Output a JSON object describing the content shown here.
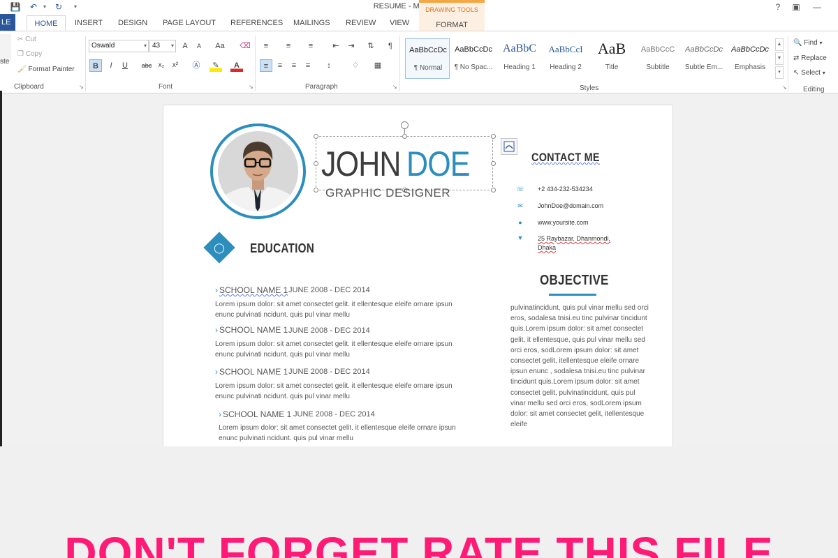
{
  "window": {
    "title": "RESUME - Microsoft Word",
    "help": "?"
  },
  "tabs": {
    "file": "LE",
    "home": "HOME",
    "insert": "INSERT",
    "design": "DESIGN",
    "page_layout": "PAGE LAYOUT",
    "references": "REFERENCES",
    "mailings": "MAILINGS",
    "review": "REVIEW",
    "view": "VIEW",
    "contextual_group": "DRAWING TOOLS",
    "format": "FORMAT"
  },
  "clipboard": {
    "paste": "ste",
    "cut": "Cut",
    "copy": "Copy",
    "format_painter": "Format Painter",
    "label": "Clipboard"
  },
  "font": {
    "family": "Oswald",
    "size": "43",
    "bold": "B",
    "italic": "I",
    "underline": "U",
    "strike": "abc",
    "subscript": "x₂",
    "superscript": "x²",
    "grow": "A",
    "shrink": "A",
    "change_case": "Aa",
    "label": "Font"
  },
  "paragraph": {
    "label": "Paragraph"
  },
  "styles": {
    "label": "Styles",
    "items": [
      {
        "preview": "AaBbCcDc",
        "name": "¶ Normal"
      },
      {
        "preview": "AaBbCcDc",
        "name": "¶ No Spac..."
      },
      {
        "preview": "AaBbC",
        "name": "Heading 1"
      },
      {
        "preview": "AaBbCcI",
        "name": "Heading 2"
      },
      {
        "preview": "AaB",
        "name": "Title"
      },
      {
        "preview": "AaBbCcC",
        "name": "Subtitle"
      },
      {
        "preview": "AaBbCcDc",
        "name": "Subtle Em..."
      },
      {
        "preview": "AaBbCcDc",
        "name": "Emphasis"
      }
    ]
  },
  "editing": {
    "find": "Find",
    "replace": "Replace",
    "select": "Select",
    "label": "Editing"
  },
  "resume": {
    "first_name": "JOHN",
    "last_name": "DOE",
    "job_title": "GRAPHIC DESIGNER",
    "education_heading": "EDUCATION",
    "education": [
      {
        "school": "SCHOOL NAME 1",
        "dates": "JUNE 2008 - DEC 2014",
        "desc": "Lorem ipsum dolor: sit amet consectet gelit. it ellentesque eleife ornare ipsun enunc pulvinati ncidunt. quis pul vinar mellu"
      },
      {
        "school": "SCHOOL NAME 1",
        "dates": "JUNE 2008 - DEC 2014",
        "desc": "Lorem ipsum dolor: sit amet consectet gelit. it ellentesque eleife ornare ipsun enunc pulvinati ncidunt. quis pul vinar mellu"
      },
      {
        "school": "SCHOOL NAME 1",
        "dates": "JUNE 2008 - DEC 2014",
        "desc": "Lorem ipsum dolor: sit amet consectet gelit. it ellentesque eleife ornare ipsun enunc pulvinati ncidunt. quis pul vinar mellu"
      },
      {
        "school": "SCHOOL NAME 1",
        "dates": "JUNE 2008 - DEC 2014",
        "desc": "Lorem ipsum dolor: sit amet consectet gelit. it ellentesque eleife ornare ipsun enunc pulvinati ncidunt. quis pul vinar mellu"
      }
    ],
    "contact_heading": "CONTACT ME",
    "contact": {
      "phone": "+2 434-232-534234",
      "email": "JohnDoe@domain.com",
      "website": "www.yoursite.com",
      "address_line1": "25 Raybazar, Dhanmondi,",
      "address_line2": "Dhaka"
    },
    "objective_heading": "OBJECTIVE",
    "objective_text": "pulvinatincidunt, quis pul vinar mellu sed orci eros, sodalesa tnisi.eu tinc pulvinar tincidunt quis.Lorem ipsum dolor: sit amet consectet gelit, it ellentesque, quis pul vinar mellu sed orci eros, sodLorem ipsum dolor: sit amet consectet gelit, itellentesque eleife ornare ipsun enunc , sodalesa tnisi.eu tinc pulvinar tincidunt quis.Lorem ipsum dolor: sit amet consectet gelit, pulvinatincidunt, quis pul vinar mellu sed orci eros, sodLorem ipsum dolor: sit amet consectet gelit, itellentesque eleife"
  },
  "footer": {
    "cta": "DON'T FORGET RATE THIS FILE"
  },
  "colors": {
    "accent": "#2c8ebc",
    "word_blue": "#2b579a",
    "cta_pink": "#ff1a75"
  }
}
